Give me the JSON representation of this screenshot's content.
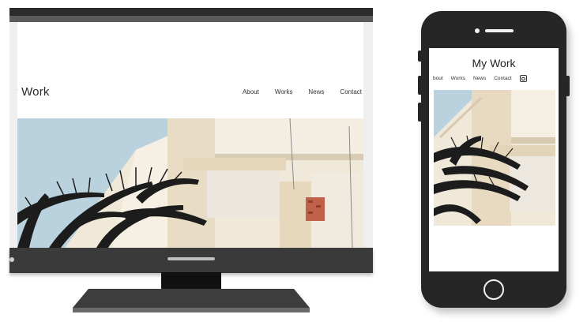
{
  "desktop": {
    "logo": "y Work",
    "nav": [
      "About",
      "Works",
      "News",
      "Contact"
    ],
    "hero_image": "building-with-palm-photo"
  },
  "phone": {
    "logo": "My Work",
    "nav": [
      "bout",
      "Works",
      "News",
      "Contact"
    ],
    "social_icon": "instagram-icon",
    "hero_image": "building-with-palm-photo"
  },
  "colors": {
    "device_dark": "#262626",
    "sky": "#b7d1dd",
    "building": "#efe6d4",
    "palm": "#1c1c1c"
  }
}
